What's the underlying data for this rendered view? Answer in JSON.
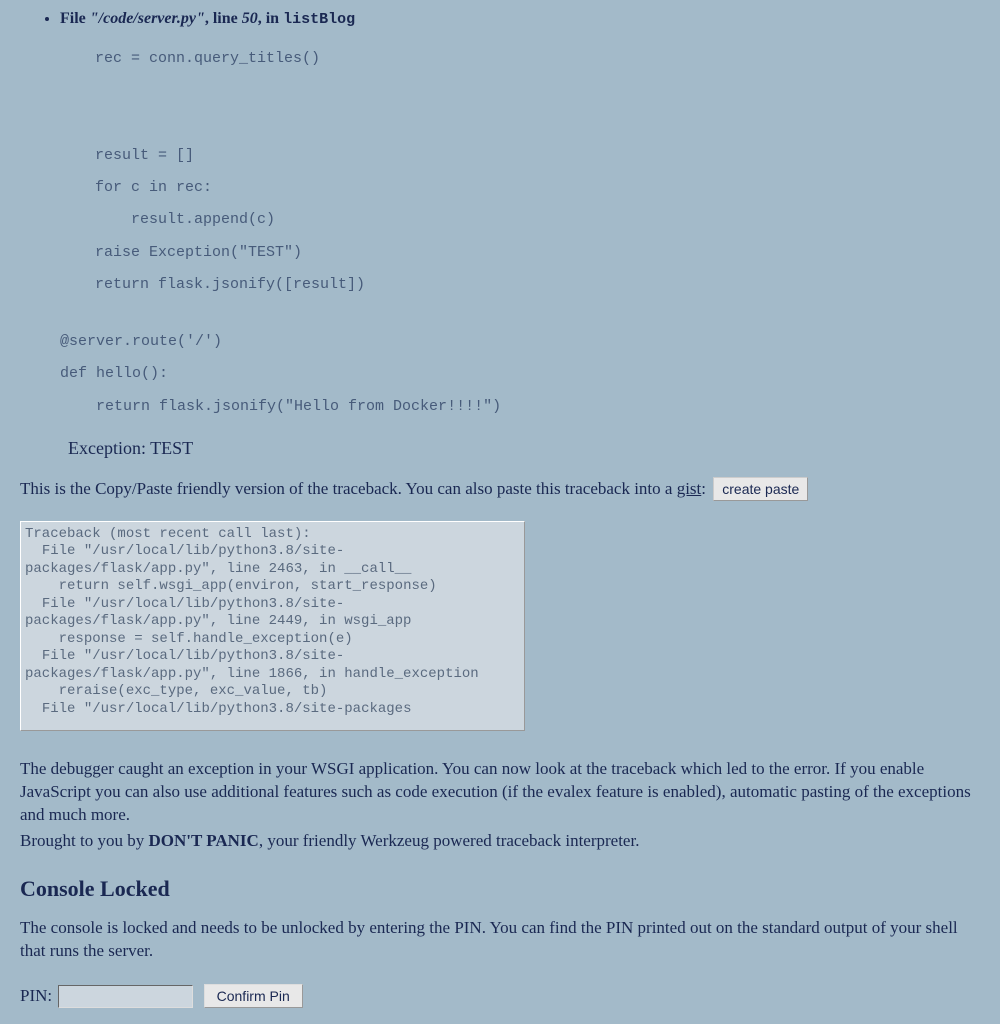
{
  "frame": {
    "file_label": "File ",
    "file_path": "\"/code/server.py\"",
    "line_label": ", line ",
    "line_num": "50",
    "in_label": ", in ",
    "func_name": "listBlog"
  },
  "code_lines": "rec = conn.query_titles()\n\n\nresult = []\nfor c in rec:\n    result.append(c)\nraise Exception(\"TEST\")\nreturn flask.jsonify([result])",
  "code_lines2": "@server.route('/')\ndef hello():\n    return flask.jsonify(\"Hello from Docker!!!!\")",
  "exception_line": "Exception: TEST",
  "copy_paste": {
    "pre": "This is the Copy/Paste friendly version of the traceback. You can also paste this traceback into a ",
    "link": "gist",
    "post": ":  "
  },
  "create_paste_btn": "create paste",
  "traceback_text": "Traceback (most recent call last):\n  File \"/usr/local/lib/python3.8/site-packages/flask/app.py\", line 2463, in __call__\n    return self.wsgi_app(environ, start_response)\n  File \"/usr/local/lib/python3.8/site-packages/flask/app.py\", line 2449, in wsgi_app\n    response = self.handle_exception(e)\n  File \"/usr/local/lib/python3.8/site-packages/flask/app.py\", line 1866, in handle_exception\n    reraise(exc_type, exc_value, tb)\n  File \"/usr/local/lib/python3.8/site-packages",
  "explain": "The debugger caught an exception in your WSGI application. You can now look at the traceback which led to the error. If you enable JavaScript you can also use additional features such as code execution (if the evalex feature is enabled), automatic pasting of the exceptions and much more.",
  "brought_pre": "Brought to you by ",
  "brought_bold": "DON'T PANIC",
  "brought_post": ", your friendly Werkzeug powered traceback interpreter.",
  "console_heading": "Console Locked",
  "console_para": "The console is locked and needs to be unlocked by entering the PIN. You can find the PIN printed out on the standard output of your shell that runs the server.",
  "pin_label": "PIN:",
  "confirm_btn": "Confirm Pin"
}
